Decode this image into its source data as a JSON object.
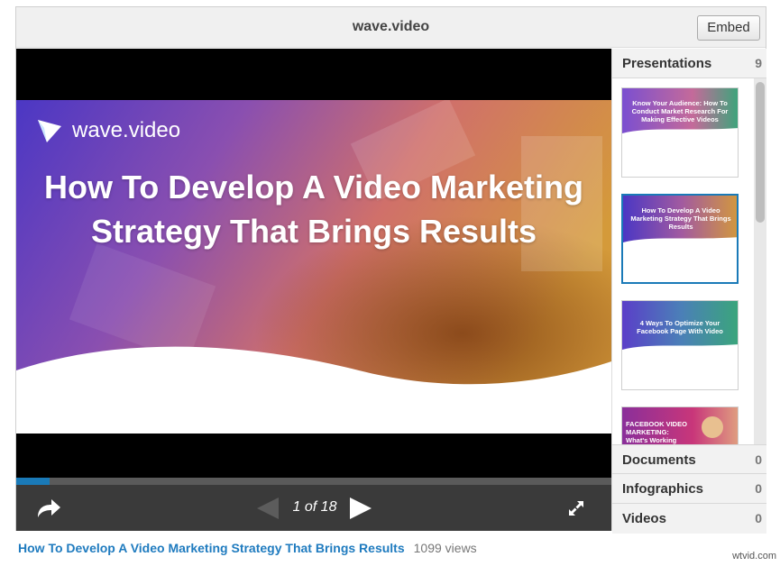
{
  "header": {
    "title": "wave.video",
    "embed_label": "Embed"
  },
  "slide": {
    "logo_text": "wave.video",
    "title": "How To Develop A Video Marketing Strategy That Brings Results"
  },
  "controls": {
    "page_indicator": "1 of 18",
    "current_page": 1,
    "total_pages": 18,
    "progress_fraction": 0.056
  },
  "sidebar": {
    "categories": [
      {
        "label": "Presentations",
        "count": "9"
      },
      {
        "label": "Documents",
        "count": "0"
      },
      {
        "label": "Infographics",
        "count": "0"
      },
      {
        "label": "Videos",
        "count": "0"
      }
    ],
    "thumbnails": [
      {
        "text": "Know Your Audience: How To Conduct Market Research For Making Effective Videos",
        "active": false
      },
      {
        "text": "How To Develop A Video Marketing Strategy That Brings Results",
        "active": true
      },
      {
        "text": "4 Ways To Optimize Your Facebook Page With Video",
        "active": false
      },
      {
        "text": "FACEBOOK VIDEO MARKETING: What's Working Now",
        "active": false
      }
    ]
  },
  "caption": {
    "title": "How To Develop A Video Marketing Strategy That Brings Results",
    "views": "1099 views"
  },
  "watermark": "wtvid.com",
  "colors": {
    "accent": "#1a7ab8",
    "link": "#1f7bbf",
    "controls_bg": "#3a3a3a"
  },
  "icons": [
    "share-icon",
    "prev-arrow-icon",
    "next-arrow-icon",
    "fullscreen-icon",
    "wave-logo-icon"
  ]
}
